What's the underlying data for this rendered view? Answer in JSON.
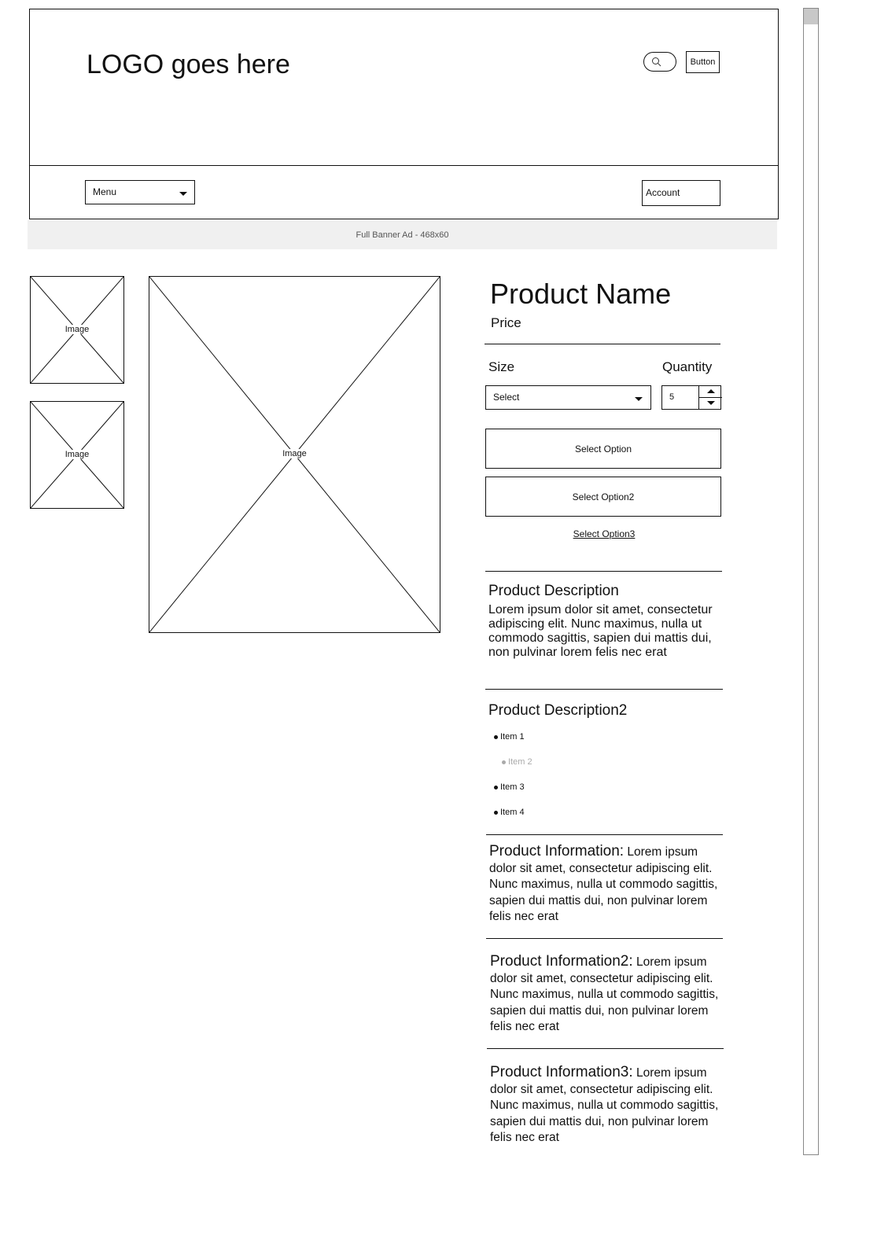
{
  "header": {
    "logo_text": "LOGO goes here",
    "search_icon": "search-icon",
    "button_label": "Button"
  },
  "nav": {
    "menu_label": "Menu",
    "account_label": "Account"
  },
  "banner": {
    "text": "Full Banner Ad - 468x60"
  },
  "gallery": {
    "thumb1_label": "Image",
    "thumb2_label": "Image",
    "main_label": "Image"
  },
  "product": {
    "name": "Product Name",
    "price": "Price",
    "size_label": "Size",
    "quantity_label": "Quantity",
    "size_selected": "Select",
    "quantity_value": "5",
    "option1": "Select Option",
    "option2": "Select Option2",
    "option3_link": "Select Option3"
  },
  "description": {
    "title": "Product Description",
    "text": "Lorem ipsum dolor sit amet, consectetur adipiscing elit. Nunc maximus, nulla ut commodo sagittis, sapien dui mattis dui, non pulvinar lorem felis nec erat"
  },
  "description2": {
    "title": "Product Description2",
    "items": [
      "Item 1",
      "Item 2",
      "Item 3",
      "Item 4"
    ]
  },
  "info": [
    {
      "title": "Product Information:",
      "text": "Lorem ipsum dolor sit amet, consectetur adipiscing elit. Nunc maximus, nulla ut commodo sagittis, sapien dui mattis dui, non pulvinar lorem felis nec erat"
    },
    {
      "title": "Product Information2:",
      "text": "Lorem ipsum dolor sit amet, consectetur adipiscing elit. Nunc maximus, nulla ut commodo sagittis, sapien dui mattis dui, non pulvinar lorem felis nec erat"
    },
    {
      "title": "Product Information3:",
      "text": "Lorem ipsum dolor sit amet, consectetur adipiscing elit. Nunc maximus, nulla ut commodo sagittis, sapien dui mattis dui, non pulvinar lorem felis nec erat"
    }
  ],
  "colors": {
    "stroke": "#111111",
    "banner_bg": "#f0f0f0",
    "dimmed_item": "#aaaaaa",
    "scroll_thumb": "#c8c8c8"
  }
}
